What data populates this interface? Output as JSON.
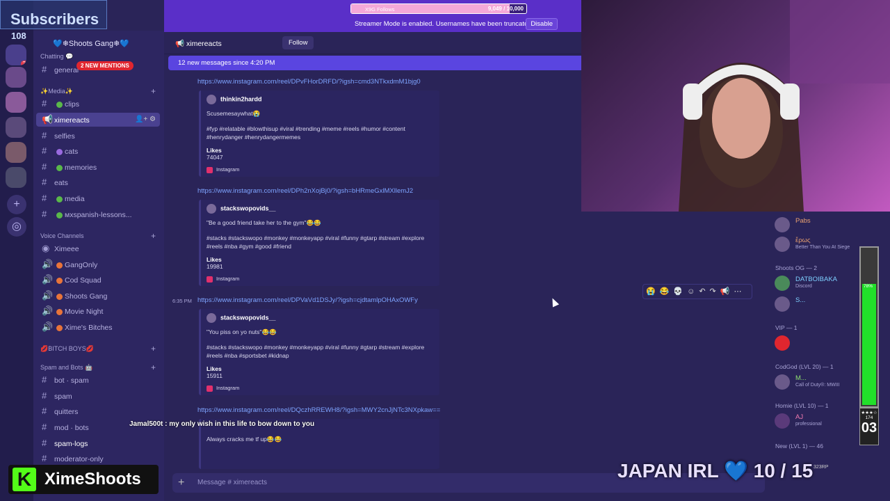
{
  "overlay": {
    "subscribers_label": "Subscribers",
    "subscribers_count": "108",
    "follow_goal": {
      "label": "X9G Follows",
      "count": "9,049 / 10,000",
      "progress": 0.9049
    },
    "chat_message": "Jamal500t : my only wish in this life to bow down to you",
    "brand": "XimeShoots",
    "stream_title": "JAPAN IRL 💙 10 / 15",
    "goal_bar": {
      "percent_label": "78%",
      "progress": 0.78,
      "stars": "★★★☆",
      "count": "174",
      "target_label": "323RP",
      "number": "03"
    }
  },
  "server": {
    "name": "💙❄Shoots Gang❄💙"
  },
  "mentions_pill": "2 NEW MENTIONS",
  "categories": {
    "chatting": "Chatting 💬",
    "media": "✨Media✨",
    "voice": "Voice Channels",
    "bitch_boys": "💋BITCH BOYS💋",
    "spam_bots": "Spam and Bots 🤖"
  },
  "channels": {
    "general": "general",
    "clips": "clips",
    "ximereacts": "ximereacts",
    "selfies": "selfies",
    "cats": "cats",
    "memories": "memories",
    "eats": "eats",
    "media": "media",
    "spanish": "ᴍxspanish-lessons...",
    "voice_ximeee": "Ximeee",
    "voice_gangonly": "GangOnly",
    "voice_codsquad": "Cod Squad",
    "voice_shootsgang": "Shoots Gang",
    "voice_movienight": "Movie Night",
    "voice_ximes": "Xime's Bitches",
    "bot_spam": "bot · spam",
    "spam": "spam",
    "quitters": "quitters",
    "mod_bots": "mod · bots",
    "spam_logs": "spam-logs",
    "moderator_only": "moderator-only"
  },
  "streamer_mode": {
    "text": "Streamer Mode is enabled. Usernames have been truncated.",
    "button": "Disable"
  },
  "header": {
    "channel": "ximereacts",
    "follow": "Follow"
  },
  "new_messages": "12 new messages since 4:20 PM",
  "messages": [
    {
      "link": "https://www.instagram.com/reel/DPvFHorDRFD/?igsh=cmd3NTkxdmM1bjg0",
      "author": "thinkin2hardd",
      "desc": "Scusemesaywhat😭",
      "tags": "#fyp #relatable #blowthisup #viral #trending #meme #reels #humor #content #henrydanger #henrydangermemes",
      "likes_label": "Likes",
      "likes": "74047",
      "source": "Instagram"
    },
    {
      "link": "https://www.instagram.com/reel/DPh2nXojBj0/?igsh=bHRmeGxlMXllemJ2",
      "author": "stackswopovids__",
      "desc": "\"Be a good friend take her to the gym\"😂😂",
      "tags": "#stacks #stackswopo #monkey #monkeyapp #viral #funny #gtarp #stream #explore #reels #nba #gym #good #friend",
      "likes_label": "Likes",
      "likes": "19981",
      "source": "Instagram"
    },
    {
      "timestamp": "6:35 PM",
      "link": "https://www.instagram.com/reel/DPVaVd1DSJy/?igsh=cjdtamlpOHAxOWFy",
      "author": "stackswopovids__",
      "desc": "\"You piss on yo nuts\"😂😂",
      "tags": "#stacks #stackswopo #monkey #monkeyapp #viral #funny #gtarp #stream #explore #reels #nba #sportsbet #kidnap",
      "likes_label": "Likes",
      "likes": "15911",
      "source": "Instagram"
    },
    {
      "link": "https://www.instagram.com/reel/DQczhRREWH8/?igsh=MWY2cnJjNTc3NXpkaw==",
      "desc": "Always cracks me tf up😂😂"
    }
  ],
  "message_actions": "😭😂💀☺↶↷📢⋯",
  "composer": {
    "placeholder": "Message # ximereacts"
  },
  "members": {
    "pabs": "Pabs",
    "eros": "ἔρως",
    "eros_status": "Better Than You At Siege",
    "shoots_og_header": "Shoots OG — 2",
    "datboibaka": "DATBOIBAKA",
    "datboibaka_status": "Discord",
    "s_member": "S...",
    "vip_header": "VIP — 1",
    "codgod_header": "CodGod (LVL 20) — 1",
    "m_member": "M...",
    "m_status": "Call of Duty®: MWIII",
    "homie_header": "Homie (LVL 10) — 1",
    "aj_member": "AJ",
    "aj_status": "professional",
    "new_header": "New (LVL 1) — 46"
  }
}
